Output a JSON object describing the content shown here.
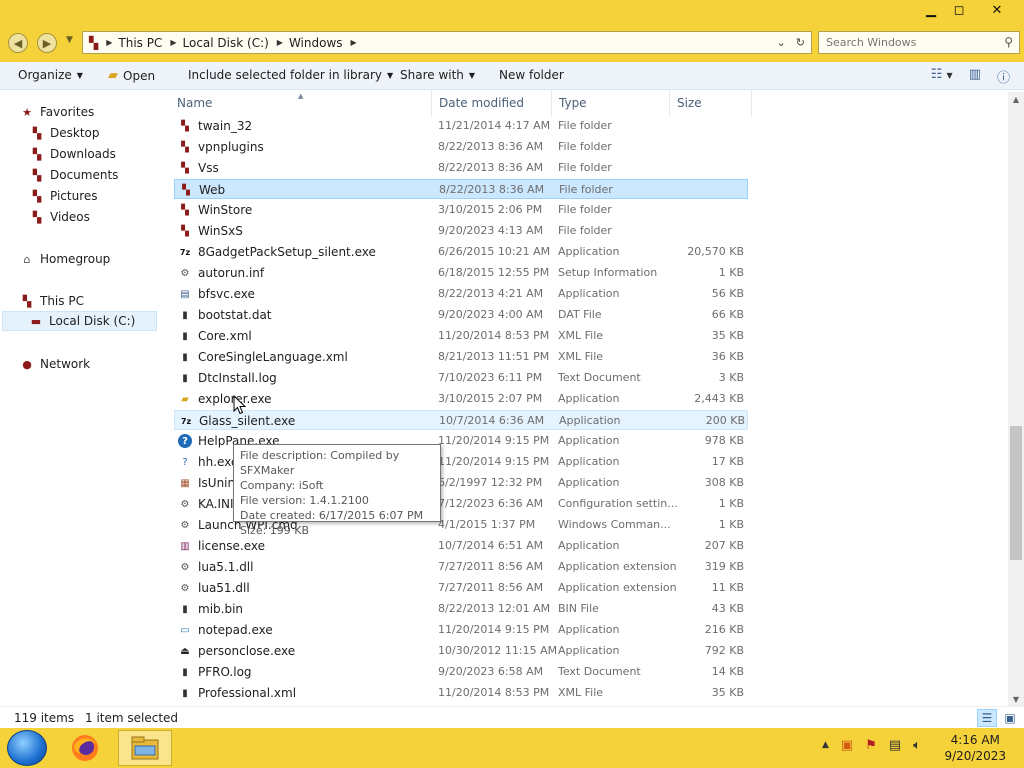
{
  "window": {
    "minimize_glyph": "▁",
    "maximize_glyph": "◻",
    "close_glyph": "✕"
  },
  "address": {
    "breadcrumbs": [
      "This PC",
      "Local Disk (C:)",
      "Windows"
    ],
    "search_placeholder": "Search Windows"
  },
  "toolbar": {
    "organize": "Organize",
    "open": "Open",
    "include_library": "Include selected folder in library",
    "share_with": "Share with",
    "new_folder": "New folder"
  },
  "nav": {
    "favorites": "Favorites",
    "desktop": "Desktop",
    "downloads": "Downloads",
    "documents": "Documents",
    "pictures": "Pictures",
    "videos": "Videos",
    "homegroup": "Homegroup",
    "this_pc": "This PC",
    "local_disk": "Local Disk (C:)",
    "network": "Network"
  },
  "columns": {
    "name": "Name",
    "date": "Date modified",
    "type": "Type",
    "size": "Size"
  },
  "files": [
    {
      "name": "twain_32",
      "date": "11/21/2014 4:17 AM",
      "type": "File folder",
      "size": "",
      "icon": "folder-icon"
    },
    {
      "name": "vpnplugins",
      "date": "8/22/2013 8:36 AM",
      "type": "File folder",
      "size": "",
      "icon": "folder-icon"
    },
    {
      "name": "Vss",
      "date": "8/22/2013 8:36 AM",
      "type": "File folder",
      "size": "",
      "icon": "folder-icon"
    },
    {
      "name": "Web",
      "date": "8/22/2013 8:36 AM",
      "type": "File folder",
      "size": "",
      "icon": "folder-icon"
    },
    {
      "name": "WinStore",
      "date": "3/10/2015 2:06 PM",
      "type": "File folder",
      "size": "",
      "icon": "folder-icon"
    },
    {
      "name": "WinSxS",
      "date": "9/20/2023 4:13 AM",
      "type": "File folder",
      "size": "",
      "icon": "folder-icon"
    },
    {
      "name": "8GadgetPackSetup_silent.exe",
      "date": "6/26/2015 10:21 AM",
      "type": "Application",
      "size": "20,570 KB",
      "icon": "sfx-archive-icon"
    },
    {
      "name": "autorun.inf",
      "date": "6/18/2015 12:55 PM",
      "type": "Setup Information",
      "size": "1 KB",
      "icon": "settings-file-icon"
    },
    {
      "name": "bfsvc.exe",
      "date": "8/22/2013 4:21 AM",
      "type": "Application",
      "size": "56 KB",
      "icon": "app-window-icon"
    },
    {
      "name": "bootstat.dat",
      "date": "9/20/2023 4:00 AM",
      "type": "DAT File",
      "size": "66 KB",
      "icon": "file-icon"
    },
    {
      "name": "Core.xml",
      "date": "11/20/2014 8:53 PM",
      "type": "XML File",
      "size": "35 KB",
      "icon": "file-icon"
    },
    {
      "name": "CoreSingleLanguage.xml",
      "date": "8/21/2013 11:51 PM",
      "type": "XML File",
      "size": "36 KB",
      "icon": "file-icon"
    },
    {
      "name": "DtcInstall.log",
      "date": "7/10/2023 6:11 PM",
      "type": "Text Document",
      "size": "3 KB",
      "icon": "file-icon"
    },
    {
      "name": "explorer.exe",
      "date": "3/10/2015 2:07 PM",
      "type": "Application",
      "size": "2,443 KB",
      "icon": "explorer-icon"
    },
    {
      "name": "Glass_silent.exe",
      "date": "10/7/2014 6:36 AM",
      "type": "Application",
      "size": "200 KB",
      "icon": "sfx-archive-icon"
    },
    {
      "name": "HelpPane.exe",
      "date": "11/20/2014 9:15 PM",
      "type": "Application",
      "size": "978 KB",
      "icon": "help-icon"
    },
    {
      "name": "hh.exe",
      "date": "11/20/2014 9:15 PM",
      "type": "Application",
      "size": "17 KB",
      "icon": "help-file-icon"
    },
    {
      "name": "IsUnins",
      "date": "6/2/1997 12:32 PM",
      "type": "Application",
      "size": "308 KB",
      "icon": "uninstall-icon"
    },
    {
      "name": "KA.INI",
      "date": "7/12/2023 6:36 AM",
      "type": "Configuration settin...",
      "size": "1 KB",
      "icon": "settings-file-icon"
    },
    {
      "name": "Launch WPI.cmd",
      "date": "4/1/2015 1:37 PM",
      "type": "Windows Comman...",
      "size": "1 KB",
      "icon": "settings-file-icon"
    },
    {
      "name": "license.exe",
      "date": "10/7/2014 6:51 AM",
      "type": "Application",
      "size": "207 KB",
      "icon": "winrar-icon"
    },
    {
      "name": "lua5.1.dll",
      "date": "7/27/2011 8:56 AM",
      "type": "Application extension",
      "size": "319 KB",
      "icon": "settings-file-icon"
    },
    {
      "name": "lua51.dll",
      "date": "7/27/2011 8:56 AM",
      "type": "Application extension",
      "size": "11 KB",
      "icon": "settings-file-icon"
    },
    {
      "name": "mib.bin",
      "date": "8/22/2013 12:01 AM",
      "type": "BIN File",
      "size": "43 KB",
      "icon": "file-icon"
    },
    {
      "name": "notepad.exe",
      "date": "11/20/2014 9:15 PM",
      "type": "Application",
      "size": "216 KB",
      "icon": "notepad-icon"
    },
    {
      "name": "personclose.exe",
      "date": "10/30/2012 11:15 AM",
      "type": "Application",
      "size": "792 KB",
      "icon": "eject-icon"
    },
    {
      "name": "PFRO.log",
      "date": "9/20/2023 6:58 AM",
      "type": "Text Document",
      "size": "14 KB",
      "icon": "file-icon"
    },
    {
      "name": "Professional.xml",
      "date": "11/20/2014 8:53 PM",
      "type": "XML File",
      "size": "35 KB",
      "icon": "file-icon"
    }
  ],
  "tooltip": {
    "line1": "File description: Compiled by SFXMaker",
    "line2": "Company: iSoft",
    "line3": "File version: 1.4.1.2100",
    "line4": "Date created: 6/17/2015 6:07 PM",
    "line5": "Size: 199 KB"
  },
  "status": {
    "items": "119 items",
    "selected": "1 item selected"
  },
  "clock": {
    "time": "4:16 AM",
    "date": "9/20/2023"
  },
  "colors": {
    "titlebar": "#f6d23a",
    "selection": "#cce8ff",
    "folder": "#8b1a1a"
  }
}
